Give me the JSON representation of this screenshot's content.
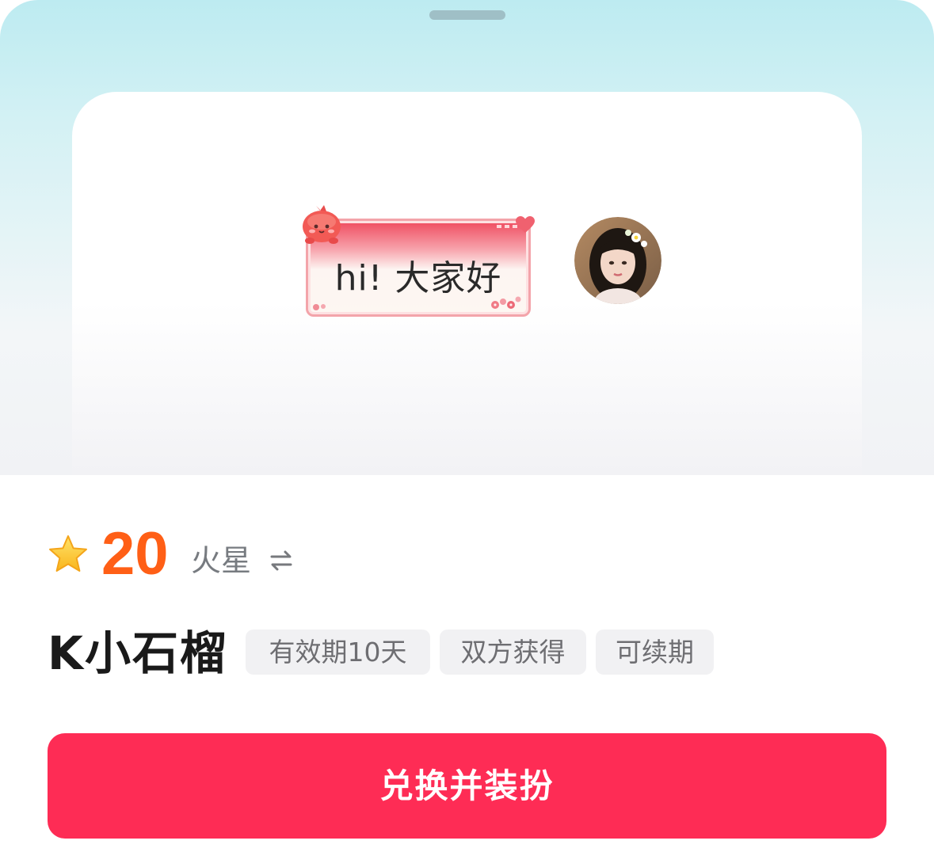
{
  "preview": {
    "bubble_text": "hi! 大家好"
  },
  "price": {
    "amount": "20",
    "currency": "火星",
    "icons": [
      "star-icon",
      "swap-icon"
    ]
  },
  "item": {
    "name": "K小石榴",
    "tags": [
      "有效期10天",
      "双方获得",
      "可续期"
    ]
  },
  "cta": {
    "label": "兑换并装扮"
  },
  "colors": {
    "accent": "#fe2c55",
    "price": "#ff5f16",
    "hero_top": "#bdebf1"
  }
}
